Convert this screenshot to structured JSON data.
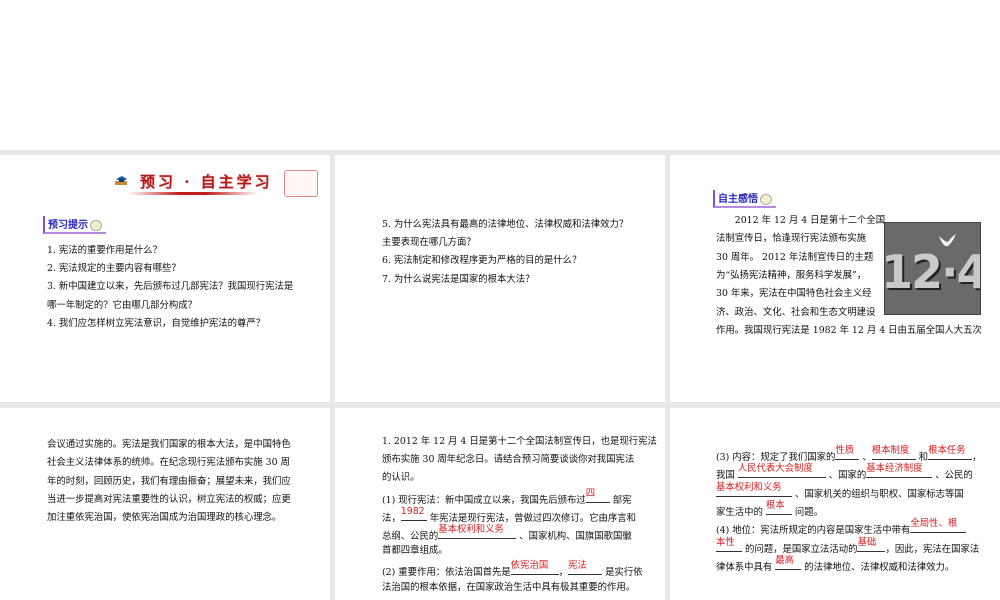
{
  "slide1": {
    "banner_title": "预习 · 自主学习",
    "tag": "预习提示",
    "lines": [
      "1. 宪法的重要作用是什么？",
      "2. 宪法规定的主要内容有哪些？",
      "3. 新中国建立以来，先后颁布过几部宪法？我国现行宪法是",
      "哪一年制定的？它由哪几部分构成？",
      "4. 我们应怎样树立宪法意识，自觉维护宪法的尊严？"
    ]
  },
  "slide2": {
    "lines": [
      "5. 为什么宪法具有最高的法律地位、法律权威和法律效力？",
      "主要表现在哪几方面？",
      "6. 宪法制定和修改程序更为严格的目的是什么？",
      "7. 为什么说宪法是国家的根本大法？"
    ]
  },
  "slide3": {
    "tag": "自主感悟",
    "photo_text": "12·4",
    "lines": [
      "　　2012 年 12 月 4 日是第十二个全国",
      "法制宣传日，恰逢现行宪法颁布实施",
      "30 周年。 2012 年法制宣传日的主题",
      "为“弘扬宪法精神，服务科学发展”，",
      "30 年来，宪法在中国特色社会主义经",
      "济、政治、文化、社会和生态文明建设",
      "作用。我国现行宪法是 1982 年 12 月 4 日由五届全国人大五次"
    ]
  },
  "slide4": {
    "lines": [
      "会议通过实施的。宪法是我们国家的根本大法，是中国特色",
      "社会主义法律体系的统帅。在纪念现行宪法颁布实施 30 周",
      "年的时刻，回顾历史，我们有理由振奋；展望未来，我们应",
      "当进一步提高对宪法重要性的认识，树立宪法的权威；应更",
      "加注重依宪治国，使依宪治国成为治国理政的核心理念。"
    ]
  },
  "slide5": {
    "lines": [
      [
        {
          "t": "1. 2012 年 12 月 4 日是第十二个全国法制宣传日，也是现行宪法"
        }
      ],
      [
        {
          "t": "颁布实施 30 周年纪念日。请结合预习简要谈谈你对我国宪法"
        }
      ],
      [
        {
          "t": "的认识。"
        }
      ],
      [
        {
          "t": "(1) 现行宪法：新中国成立以来，我国先后颁布过"
        },
        {
          "a": "四",
          "w": 24
        },
        {
          "t": " 部宪"
        }
      ],
      [
        {
          "t": "法，"
        },
        {
          "a": "1982",
          "w": 26
        },
        {
          "t": " 年宪法是现行宪法，曾做过四次修订。它由序言和"
        }
      ],
      [
        {
          "t": "总纲、公民的"
        },
        {
          "a": "基本权利和义务",
          "w": 78
        },
        {
          "t": " 、国家机构、国旗国歌国徽"
        }
      ],
      [
        {
          "t": "首都四章组成。"
        }
      ],
      [
        {
          "t": "(2) 重要作用：依法治国首先是"
        },
        {
          "a": "依宪治国",
          "w": 48
        },
        {
          "t": "，"
        },
        {
          "a": "宪法",
          "w": 34
        },
        {
          "t": " 是实行依"
        }
      ],
      [
        {
          "t": "法治国的根本依据，在国家政治生活中具有极其重要的作用。"
        }
      ]
    ]
  },
  "slide6": {
    "lines": [
      [
        {
          "t": "(3) 内容：规定了我们国家的"
        },
        {
          "a": "性质",
          "w": 24
        },
        {
          "t": " 、"
        },
        {
          "a": "根本制度",
          "w": 44
        },
        {
          "t": " 和"
        },
        {
          "a": "根本任务",
          "w": 44
        },
        {
          "t": "，"
        }
      ],
      [
        {
          "t": "我国 "
        },
        {
          "a": "人民代表大会制度",
          "w": 88
        },
        {
          "t": " 、国家的"
        },
        {
          "a": "基本经济制度",
          "w": 66
        },
        {
          "t": " 、公民的"
        }
      ],
      [
        {
          "a": "基本权利和义务",
          "w": 76
        },
        {
          "t": " 、国家机关的组织与职权、国家标志等国"
        }
      ],
      [
        {
          "t": "家生活中的 "
        },
        {
          "a": "根本",
          "w": 26
        },
        {
          "t": " 问题。"
        }
      ],
      [
        {
          "t": "(4) 地位：宪法所规定的内容是国家生活中带有"
        },
        {
          "a": "全局性、根",
          "w": 56
        }
      ],
      [
        {
          "a": "本性",
          "w": 26
        },
        {
          "t": " 的问题，是国家立法活动的"
        },
        {
          "a": "基础",
          "w": 28
        },
        {
          "t": "，因此，宪法在国家法"
        }
      ],
      [
        {
          "t": "律体系中具有 "
        },
        {
          "a": "最高",
          "w": 26
        },
        {
          "t": " 的法律地位、法律权威和法律效力。"
        }
      ]
    ]
  }
}
